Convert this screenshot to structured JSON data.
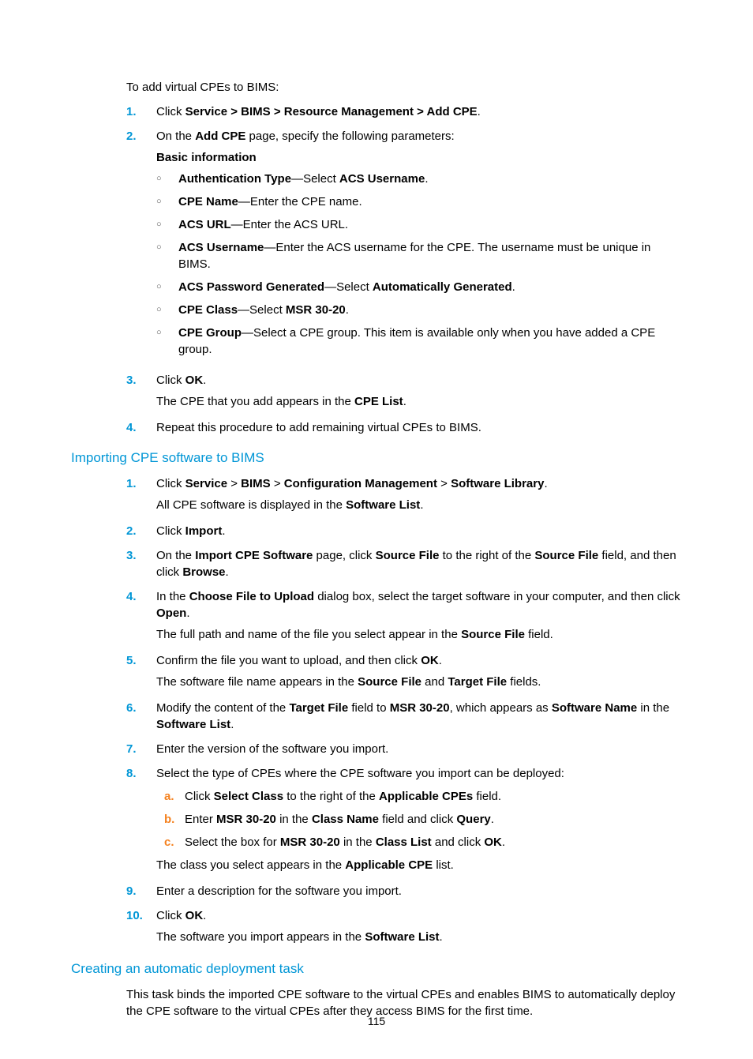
{
  "intro": "To add virtual CPEs to BIMS:",
  "s1": {
    "i1_pre": "Click ",
    "i1_b": "Service > BIMS > Resource Management > Add CPE",
    "i1_post": ".",
    "i2_pre": "On the ",
    "i2_b": "Add CPE",
    "i2_post": " page, specify the following parameters:",
    "basic": "Basic information",
    "c1_b": "Authentication Type",
    "c1_mid": "—Select ",
    "c1_b2": "ACS Username",
    "c1_post": ".",
    "c2_b": "CPE Name",
    "c2_post": "—Enter the CPE name.",
    "c3_b": "ACS URL",
    "c3_post": "—Enter the ACS URL.",
    "c4_b": "ACS Username",
    "c4_post": "—Enter the ACS username for the CPE. The username must be unique in BIMS.",
    "c5_b": "ACS Password Generated",
    "c5_mid": "—Select ",
    "c5_b2": "Automatically Generated",
    "c5_post": ".",
    "c6_b": "CPE Class",
    "c6_mid": "—Select ",
    "c6_b2": "MSR 30-20",
    "c6_post": ".",
    "c7_b": "CPE Group",
    "c7_post": "—Select a CPE group. This item is available only when you have added a CPE group.",
    "i3_pre": "Click ",
    "i3_b": "OK",
    "i3_post": ".",
    "i3_sub_pre": "The CPE that you add appears in the ",
    "i3_sub_b": "CPE List",
    "i3_sub_post": ".",
    "i4": "Repeat this procedure to add remaining virtual CPEs to BIMS."
  },
  "h2a": "Importing CPE software to BIMS",
  "s2": {
    "i1_a": "Click ",
    "i1_b1": "Service",
    "i1_c": " > ",
    "i1_b2": "BIMS",
    "i1_b3": "Configuration Management",
    "i1_b4": "Software Library",
    "i1_post": ".",
    "i1_sub_pre": "All CPE software is displayed in the ",
    "i1_sub_b": "Software List",
    "i1_sub_post": ".",
    "i2_pre": "Click ",
    "i2_b": "Import",
    "i2_post": ".",
    "i3_a": "On the ",
    "i3_b1": "Import CPE Software",
    "i3_c": " page, click ",
    "i3_b2": "Source File",
    "i3_d": " to the right of the ",
    "i3_b3": "Source File",
    "i3_e": " field, and then click ",
    "i3_b4": "Browse",
    "i3_post": ".",
    "i4_a": "In the ",
    "i4_b1": "Choose File to Upload",
    "i4_c": " dialog box, select the target software in your computer, and then click ",
    "i4_b2": "Open",
    "i4_post": ".",
    "i4_sub_a": "The full path and name of the file you select appear in the ",
    "i4_sub_b": "Source File",
    "i4_sub_c": " field.",
    "i5_a": "Confirm the file you want to upload, and then click ",
    "i5_b": "OK",
    "i5_post": ".",
    "i5_sub_a": "The software file name appears in the ",
    "i5_sub_b1": "Source File",
    "i5_sub_c": " and ",
    "i5_sub_b2": "Target File",
    "i5_sub_d": " fields.",
    "i6_a": "Modify the content of the ",
    "i6_b1": "Target File",
    "i6_c": " field to ",
    "i6_b2": "MSR 30-20",
    "i6_d": ", which appears as ",
    "i6_b3": "Software Name",
    "i6_e": " in the ",
    "i6_b4": "Software List",
    "i6_post": ".",
    "i7": "Enter the version of the software you import.",
    "i8": "Select the type of CPEs where the CPE software you import can be deployed:",
    "a1_a": "Click ",
    "a1_b1": "Select Class",
    "a1_c": " to the right of the ",
    "a1_b2": "Applicable CPEs",
    "a1_d": " field.",
    "a2_a": "Enter ",
    "a2_b1": "MSR 30-20",
    "a2_c": " in the ",
    "a2_b2": "Class Name",
    "a2_d": " field and click ",
    "a2_b3": "Query",
    "a2_post": ".",
    "a3_a": "Select the box for ",
    "a3_b1": "MSR 30-20",
    "a3_c": " in the ",
    "a3_b2": "Class List",
    "a3_d": " and click ",
    "a3_b3": "OK",
    "a3_post": ".",
    "i8_sub_a": "The class you select appears in the ",
    "i8_sub_b": "Applicable CPE",
    "i8_sub_c": " list.",
    "i9": "Enter a description for the software you import.",
    "i10_pre": "Click ",
    "i10_b": "OK",
    "i10_post": ".",
    "i10_sub_a": "The software you import appears in the ",
    "i10_sub_b": "Software List",
    "i10_sub_c": "."
  },
  "h2b": "Creating an automatic deployment task",
  "s3": {
    "p": "This task binds the imported CPE software to the virtual CPEs and enables BIMS to automatically deploy the CPE software to the virtual CPEs after they access BIMS for the first time."
  },
  "nums": {
    "n1": "1.",
    "n2": "2.",
    "n3": "3.",
    "n4": "4.",
    "n5": "5.",
    "n6": "6.",
    "n7": "7.",
    "n8": "8.",
    "n9": "9.",
    "n10": "10."
  },
  "alpha": {
    "a": "a.",
    "b": "b.",
    "c": "c."
  },
  "bullet": "○",
  "pagenum": "115"
}
